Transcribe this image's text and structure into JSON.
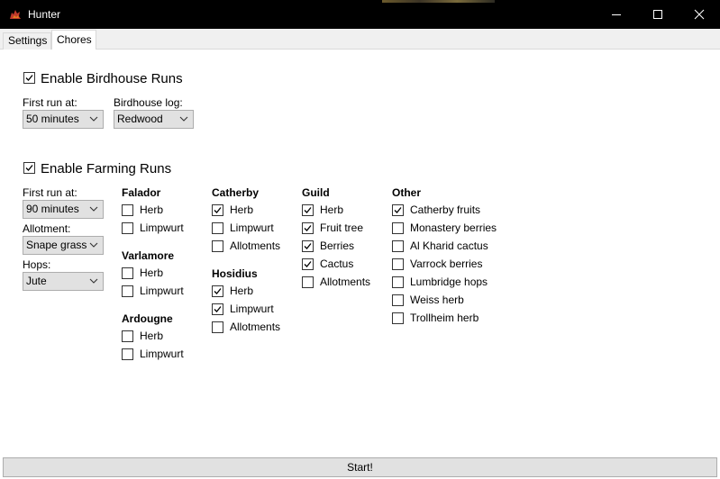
{
  "window": {
    "title": "Hunter"
  },
  "tabs": [
    {
      "label": "Settings",
      "selected": false
    },
    {
      "label": "Chores",
      "selected": true
    }
  ],
  "birdhouse": {
    "enable_label": "Enable Birdhouse Runs",
    "enabled": true,
    "first_run_label": "First run at:",
    "first_run_value": "50 minutes",
    "log_label": "Birdhouse log:",
    "log_value": "Redwood"
  },
  "farming": {
    "enable_label": "Enable Farming Runs",
    "enabled": true,
    "first_run_label": "First run at:",
    "first_run_value": "90 minutes",
    "allotment_label": "Allotment:",
    "allotment_value": "Snape grass",
    "hops_label": "Hops:",
    "hops_value": "Jute",
    "groups": {
      "falador": {
        "title": "Falador",
        "items": [
          {
            "label": "Herb",
            "checked": false
          },
          {
            "label": "Limpwurt",
            "checked": false
          }
        ]
      },
      "varlamore": {
        "title": "Varlamore",
        "items": [
          {
            "label": "Herb",
            "checked": false
          },
          {
            "label": "Limpwurt",
            "checked": false
          }
        ]
      },
      "ardougne": {
        "title": "Ardougne",
        "items": [
          {
            "label": "Herb",
            "checked": false
          },
          {
            "label": "Limpwurt",
            "checked": false
          }
        ]
      },
      "catherby": {
        "title": "Catherby",
        "items": [
          {
            "label": "Herb",
            "checked": true
          },
          {
            "label": "Limpwurt",
            "checked": false
          },
          {
            "label": "Allotments",
            "checked": false
          }
        ]
      },
      "hosidius": {
        "title": "Hosidius",
        "items": [
          {
            "label": "Herb",
            "checked": true
          },
          {
            "label": "Limpwurt",
            "checked": true
          },
          {
            "label": "Allotments",
            "checked": false
          }
        ]
      },
      "guild": {
        "title": "Guild",
        "items": [
          {
            "label": "Herb",
            "checked": true
          },
          {
            "label": "Fruit tree",
            "checked": true
          },
          {
            "label": "Berries",
            "checked": true
          },
          {
            "label": "Cactus",
            "checked": true
          },
          {
            "label": "Allotments",
            "checked": false
          }
        ]
      },
      "other": {
        "title": "Other",
        "items": [
          {
            "label": "Catherby fruits",
            "checked": true
          },
          {
            "label": "Monastery berries",
            "checked": false
          },
          {
            "label": "Al Kharid cactus",
            "checked": false
          },
          {
            "label": "Varrock berries",
            "checked": false
          },
          {
            "label": "Lumbridge hops",
            "checked": false
          },
          {
            "label": "Weiss herb",
            "checked": false
          },
          {
            "label": "Trollheim herb",
            "checked": false
          }
        ]
      }
    }
  },
  "start_button": {
    "label": "Start!"
  },
  "colors": {
    "titlebar": "#000000",
    "accent_icon": "#c0392b",
    "button_face": "#e1e1e1"
  }
}
